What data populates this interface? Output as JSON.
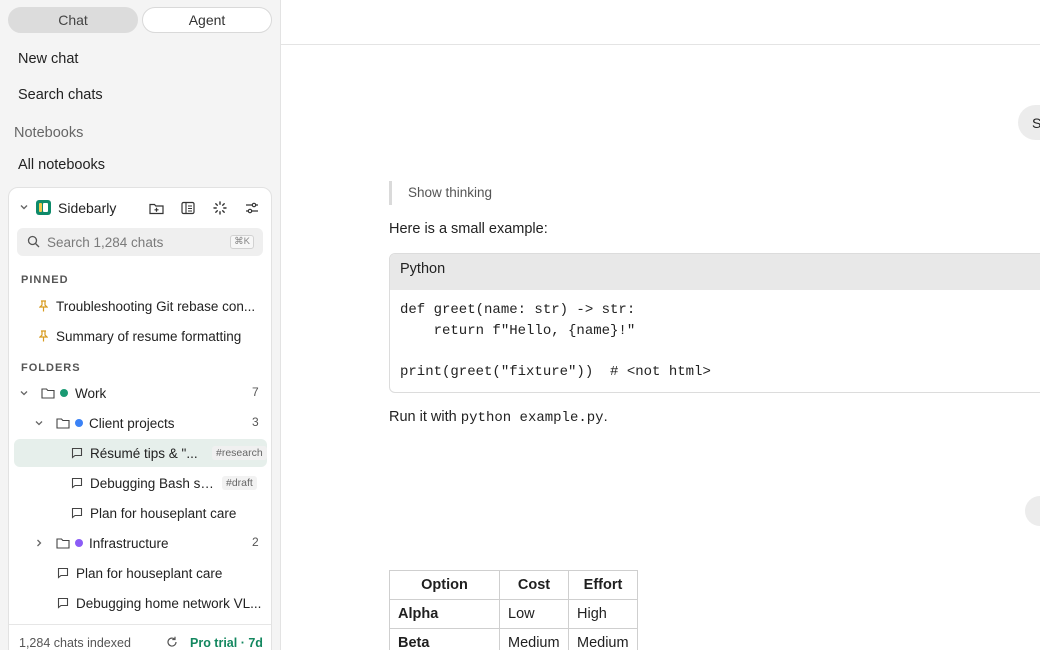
{
  "modes": {
    "chat": "Chat",
    "agent": "Agent"
  },
  "nav": {
    "new_chat": "New chat",
    "search_chats": "Search chats",
    "notebooks": "Notebooks",
    "all_notebooks": "All notebooks"
  },
  "panel": {
    "brand": "Sidebarly",
    "search_placeholder": "Search 1,284 chats",
    "search_shortcut": "⌘K",
    "pinned_label": "PINNED",
    "pinned": [
      "Troubleshooting Git rebase con...",
      "Summary of resume formatting"
    ],
    "folders_label": "FOLDERS",
    "folders": {
      "work": {
        "name": "Work",
        "count": "7",
        "color": "#1a9a73"
      },
      "client_projects": {
        "name": "Client projects",
        "count": "3",
        "color": "#3b82f6"
      },
      "infrastructure": {
        "name": "Infrastructure",
        "count": "2",
        "color": "#8b5cf6"
      }
    },
    "chats": {
      "resume": {
        "title": "Résumé tips & \"...",
        "tag": "#research"
      },
      "bash": {
        "title": "Debugging Bash sc...",
        "tag": "#draft"
      },
      "houseplant_nested": {
        "title": "Plan for houseplant care"
      },
      "houseplant": {
        "title": "Plan for houseplant care"
      },
      "network": {
        "title": "Debugging home network VL..."
      }
    },
    "footer": {
      "indexed": "1,284 chats indexed",
      "plan": "Pro trial · 7d"
    }
  },
  "conversation": {
    "user_message_1": "S",
    "show_thinking": "Show thinking",
    "intro": "Here is a small example:",
    "code": {
      "language": "Python",
      "lines": [
        "def greet(name: str) -> str:",
        "    return f\"Hello, {name}!\"",
        "",
        "print(greet(\"fixture\"))  # <not html>"
      ]
    },
    "run_prefix": "Run it with ",
    "run_code": "python example.py",
    "run_suffix": ".",
    "table": {
      "headers": [
        "Option",
        "Cost",
        "Effort"
      ],
      "rows": [
        [
          "Alpha",
          "Low",
          "High"
        ],
        [
          "Beta",
          "Medium",
          "Medium"
        ]
      ]
    }
  }
}
